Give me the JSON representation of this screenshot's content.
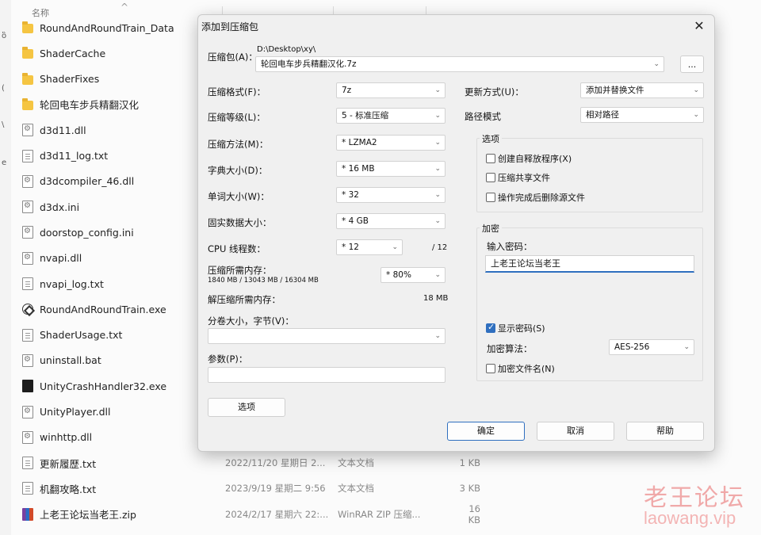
{
  "explorer": {
    "left_edge_marks": [
      "ὃ",
      "(",
      "\\",
      "e"
    ],
    "header": {
      "sort_arrow": "^",
      "name_col": "名称"
    },
    "files": [
      {
        "name": "RoundAndRoundTrain_Data",
        "icon": "folder-icon",
        "date": "",
        "type": "",
        "size": ""
      },
      {
        "name": "ShaderCache",
        "icon": "folder-icon",
        "date": "",
        "type": "",
        "size": ""
      },
      {
        "name": "ShaderFixes",
        "icon": "folder-icon",
        "date": "",
        "type": "",
        "size": ""
      },
      {
        "name": "轮回电车步兵精翻汉化",
        "icon": "folder-icon",
        "date": "",
        "type": "",
        "size": ""
      },
      {
        "name": "d3d11.dll",
        "icon": "gear-file-icon",
        "date": "",
        "type": "",
        "size": ""
      },
      {
        "name": "d3d11_log.txt",
        "icon": "text-file-icon",
        "date": "",
        "type": "",
        "size": ""
      },
      {
        "name": "d3dcompiler_46.dll",
        "icon": "gear-file-icon",
        "date": "",
        "type": "",
        "size": ""
      },
      {
        "name": "d3dx.ini",
        "icon": "gear-file-icon",
        "date": "",
        "type": "",
        "size": ""
      },
      {
        "name": "doorstop_config.ini",
        "icon": "gear-file-icon",
        "date": "",
        "type": "",
        "size": ""
      },
      {
        "name": "nvapi.dll",
        "icon": "gear-file-icon",
        "date": "",
        "type": "",
        "size": ""
      },
      {
        "name": "nvapi_log.txt",
        "icon": "text-file-icon",
        "date": "",
        "type": "",
        "size": ""
      },
      {
        "name": "RoundAndRoundTrain.exe",
        "icon": "unity-icon",
        "date": "",
        "type": "",
        "size": ""
      },
      {
        "name": "ShaderUsage.txt",
        "icon": "text-file-icon",
        "date": "",
        "type": "",
        "size": ""
      },
      {
        "name": "uninstall.bat",
        "icon": "gear-file-icon",
        "date": "",
        "type": "",
        "size": ""
      },
      {
        "name": "UnityCrashHandler32.exe",
        "icon": "black-app-icon",
        "date": "",
        "type": "",
        "size": ""
      },
      {
        "name": "UnityPlayer.dll",
        "icon": "gear-file-icon",
        "date": "",
        "type": "",
        "size": ""
      },
      {
        "name": "winhttp.dll",
        "icon": "gear-file-icon",
        "date": "",
        "type": "",
        "size": ""
      },
      {
        "name": "更新履歴.txt",
        "icon": "text-file-icon",
        "date": "2022/11/20 星期日 2...",
        "type": "文本文档",
        "size": "1 KB"
      },
      {
        "name": "机翻攻略.txt",
        "icon": "text-file-icon",
        "date": "2023/9/19 星期二 9:56",
        "type": "文本文档",
        "size": "3 KB"
      },
      {
        "name": "上老王论坛当老王.zip",
        "icon": "winrar-icon",
        "date": "2024/2/17 星期六 22:...",
        "type": "WinRAR ZIP 压缩...",
        "size": "16 KB"
      }
    ]
  },
  "watermark": {
    "cn": "老王论坛",
    "url": "laowang.vip"
  },
  "dialog": {
    "title": "添加到压缩包",
    "close": "✕",
    "archive": {
      "label": "压缩包(A)：",
      "path": "D:\\Desktop\\xy\\",
      "name": "轮回电车步兵精翻汉化.7z",
      "browse": "..."
    },
    "left": {
      "format": {
        "label": "压缩格式(F)：",
        "value": "7z"
      },
      "level": {
        "label": "压缩等级(L)：",
        "value": "5 - 标准压缩"
      },
      "method": {
        "label": "压缩方法(M)：",
        "value": "* LZMA2"
      },
      "dict": {
        "label": "字典大小(D)：",
        "value": "* 16 MB"
      },
      "word": {
        "label": "单词大小(W)：",
        "value": "* 32"
      },
      "solid": {
        "label": "固实数据大小：",
        "value": "* 4 GB"
      },
      "cpu": {
        "label": "CPU 线程数：",
        "value": "* 12",
        "max": "/ 12"
      },
      "mem_comp": {
        "label": "压缩所需内存：",
        "detail": "1840 MB / 13043 MB / 16304 MB",
        "value": "* 80%"
      },
      "mem_decomp": {
        "label": "解压缩所需内存：",
        "value": "18 MB"
      },
      "split": {
        "label": "分卷大小，字节(V)：",
        "value": ""
      },
      "params": {
        "label": "参数(P)：",
        "value": ""
      },
      "options_button": "选项"
    },
    "right": {
      "update": {
        "label": "更新方式(U)：",
        "value": "添加并替换文件"
      },
      "path_mode": {
        "label": "路径模式",
        "value": "相对路径"
      },
      "options_group": {
        "title": "选项",
        "sfx": "创建自释放程序(X)",
        "shared": "压缩共享文件",
        "delete": "操作完成后删除源文件"
      },
      "encryption": {
        "title": "加密",
        "pw_label": "输入密码：",
        "password": "上老王论坛当老王",
        "show_pw": "显示密码(S)",
        "method_label": "加密算法：",
        "method_value": "AES-256",
        "encrypt_names": "加密文件名(N)"
      }
    },
    "buttons": {
      "ok": "确定",
      "cancel": "取消",
      "help": "帮助"
    }
  }
}
